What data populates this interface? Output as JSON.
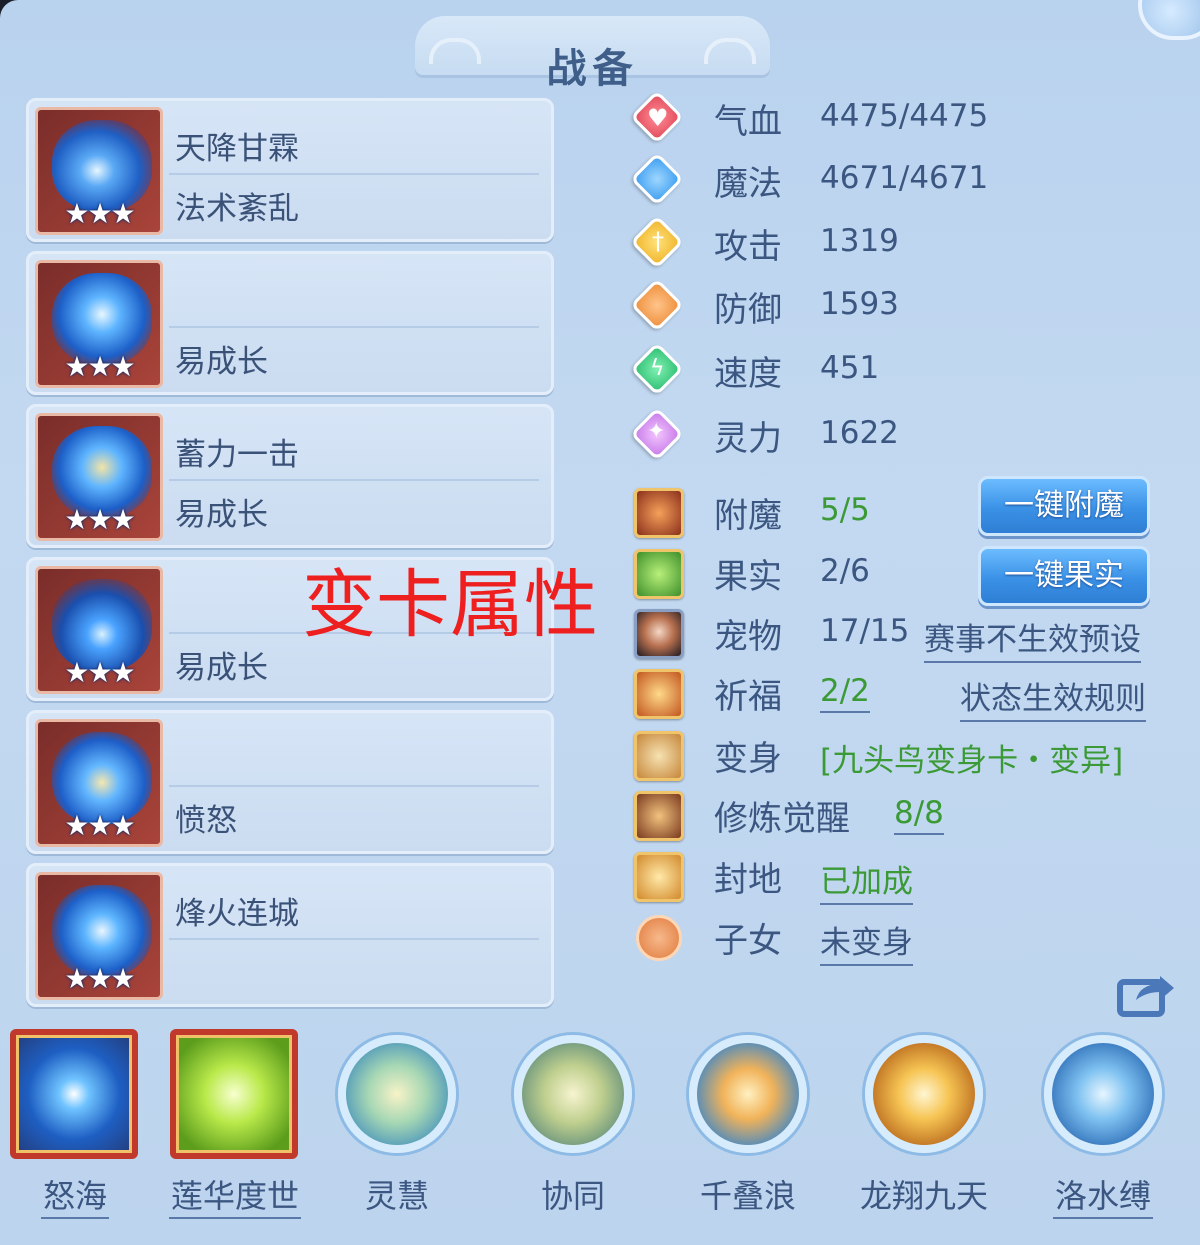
{
  "title": "战备",
  "equipment": [
    {
      "line1": "天降甘霖",
      "line2": "法术紊乱",
      "stars": "★★★"
    },
    {
      "line1": "",
      "line2": "易成长",
      "stars": "★★★"
    },
    {
      "line1": "蓄力一击",
      "line2": "易成长",
      "stars": "★★★"
    },
    {
      "line1": "",
      "line2": "易成长",
      "stars": "★★★"
    },
    {
      "line1": "",
      "line2": "愤怒",
      "stars": "★★★"
    },
    {
      "line1": "烽火连城",
      "line2": "",
      "stars": "★★★"
    }
  ],
  "overlay_text": "变卡属性",
  "stats": {
    "hp": {
      "label": "气血",
      "value": "4475/4475",
      "icon": "heart-icon"
    },
    "mp": {
      "label": "魔法",
      "value": "4671/4671",
      "icon": "mana-icon"
    },
    "atk": {
      "label": "攻击",
      "value": "1319",
      "icon": "sword-icon"
    },
    "def": {
      "label": "防御",
      "value": "1593",
      "icon": "shield-icon"
    },
    "spd": {
      "label": "速度",
      "value": "451",
      "icon": "lightning-icon"
    },
    "spi": {
      "label": "灵力",
      "value": "1622",
      "icon": "spirit-icon"
    },
    "enchant": {
      "label": "附魔",
      "value": "5/5"
    },
    "fruit": {
      "label": "果实",
      "value": "2/6"
    },
    "pet": {
      "label": "宠物",
      "value": "17/15",
      "link": "赛事不生效预设"
    },
    "bless": {
      "label": "祈福",
      "value": "2/2",
      "link": "状态生效规则"
    },
    "transform": {
      "label": "变身",
      "value": "[九头鸟变身卡・变异]"
    },
    "cultivate": {
      "label": "修炼觉醒",
      "value": "8/8"
    },
    "fief": {
      "label": "封地",
      "value": "已加成"
    },
    "child": {
      "label": "子女",
      "value": "未变身"
    }
  },
  "buttons": {
    "enchant": "一键附魔",
    "fruit": "一键果实"
  },
  "skills": [
    {
      "name": "怒海"
    },
    {
      "name": "莲华度世"
    },
    {
      "name": "灵慧"
    },
    {
      "name": "协同"
    },
    {
      "name": "千叠浪"
    },
    {
      "name": "龙翔九天"
    },
    {
      "name": "洛水缚"
    }
  ],
  "colors": {
    "panel_bg": "#c3d9f1",
    "text": "#3b5781",
    "green": "#3b9a36",
    "button": "#3a91e6",
    "overlay": "#ee1f1f"
  }
}
